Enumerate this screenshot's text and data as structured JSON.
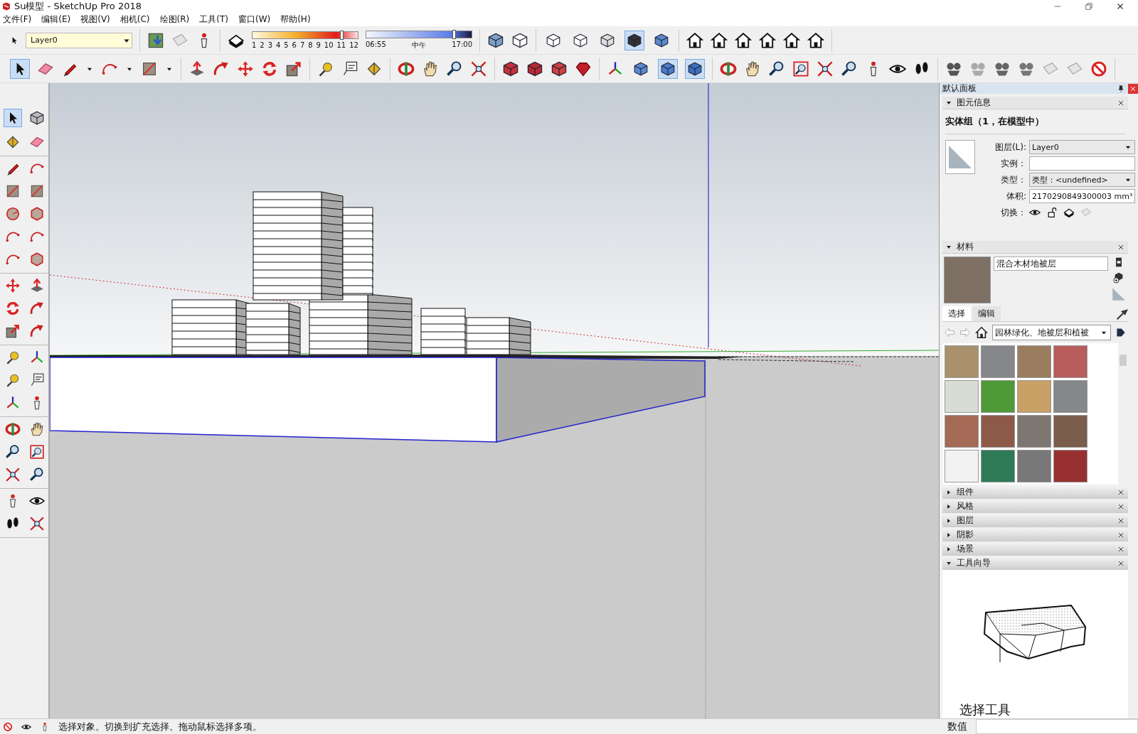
{
  "window": {
    "title": "Su模型 - SketchUp Pro 2018"
  },
  "menu": [
    "文件(F)",
    "编辑(E)",
    "视图(V)",
    "相机(C)",
    "绘图(R)",
    "工具(T)",
    "窗口(W)",
    "帮助(H)"
  ],
  "layer_toolbar": {
    "value": "Layer0"
  },
  "shadows": {
    "month_ticks": [
      "1",
      "2",
      "3",
      "4",
      "5",
      "6",
      "7",
      "8",
      "9",
      "10",
      "11",
      "12"
    ],
    "month": {
      "level": 0.83
    },
    "time": {
      "start": "06:55",
      "middle": "中午",
      "end": "17:00",
      "level": 0.82
    }
  },
  "main_toolbar": {
    "select_tool": {
      "selected": true
    },
    "face_styles": [
      {
        "selected": false
      },
      {
        "selected": false
      },
      {
        "selected": false
      },
      {
        "selected": true
      },
      {
        "selected": false
      }
    ],
    "view_toggles": [
      {
        "selected": false
      },
      {
        "selected": true
      },
      {
        "selected": true
      }
    ]
  },
  "left_toolbar": {
    "select_tool": {
      "selected": true
    }
  },
  "panel": {
    "title": "默认面板",
    "entity_info": {
      "title": "图元信息",
      "expanded": true,
      "heading": "实体组（1，在模型中）",
      "fields": [
        {
          "kind": "dropdown",
          "label": "图层(L):",
          "value": "Layer0"
        },
        {
          "kind": "input",
          "label": "实例："
        },
        {
          "kind": "dropdown",
          "label": "类型：",
          "value": "类型：<undefined>"
        },
        {
          "kind": "input",
          "label": "体积:",
          "value": "2170290849300003 mm³"
        },
        {
          "kind": "toggles",
          "label": "切换："
        }
      ]
    },
    "materials": {
      "title": "材料",
      "expanded": true,
      "name": "混合木材地被层",
      "tabs": [
        {
          "label": "选择",
          "selected": true
        },
        {
          "label": "编辑",
          "selected": false
        }
      ],
      "library": "园林绿化、地被层和植被",
      "swatches": [
        {
          "color": "#a8916c"
        },
        {
          "color": "#86878a"
        },
        {
          "color": "#9a7c5e"
        },
        {
          "color": "#b85c5c"
        },
        {
          "color": "#d8dcd4"
        },
        {
          "color": "#4e9a38"
        },
        {
          "color": "#c9a166"
        },
        {
          "color": "#85878a"
        },
        {
          "color": "#a46a55"
        },
        {
          "color": "#8e5a48"
        },
        {
          "color": "#7e7771"
        },
        {
          "color": "#7a5d4a"
        },
        {
          "color": "#f2f2f2"
        },
        {
          "color": "#2f7a56"
        },
        {
          "color": "#787878"
        },
        {
          "color": "#983030"
        }
      ]
    },
    "sections": [
      {
        "title": "组件",
        "expanded": false
      },
      {
        "title": "风格",
        "expanded": false
      },
      {
        "title": "图层",
        "expanded": false
      },
      {
        "title": "阴影",
        "expanded": false
      },
      {
        "title": "场景",
        "expanded": false
      },
      {
        "title": "工具向导",
        "expanded": true,
        "guide_title": "选择工具"
      }
    ]
  },
  "status_bar": {
    "message": "选择对象。切换到扩充选择。拖动鼠标选择多项。",
    "measurements_label": "数值"
  }
}
